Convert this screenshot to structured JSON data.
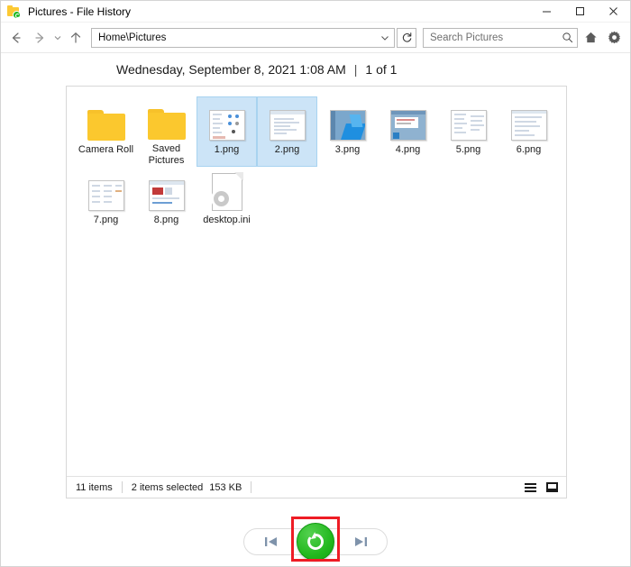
{
  "window": {
    "title": "Pictures - File History",
    "icon": "folder-history-icon",
    "controls": {
      "minimize": "minimize",
      "maximize": "maximize",
      "close": "close"
    }
  },
  "toolbar": {
    "back": "Back",
    "forward": "Forward",
    "recent": "Recent locations",
    "up": "Up",
    "address_value": "Home\\Pictures",
    "address_dropdown": "chevron-down-icon",
    "refresh": "Refresh",
    "search_placeholder": "Search Pictures",
    "search_icon": "search-icon",
    "home_icon": "home-icon",
    "settings_icon": "gear-icon"
  },
  "header": {
    "datetime": "Wednesday, September 8, 2021 1:08 AM",
    "separator": "|",
    "version_count": "1 of 1"
  },
  "files": [
    {
      "name": "Camera Roll",
      "type": "folder"
    },
    {
      "name": "Saved Pictures",
      "type": "folder"
    },
    {
      "name": "1.png",
      "type": "image",
      "selected": true
    },
    {
      "name": "2.png",
      "type": "image",
      "selected": true
    },
    {
      "name": "3.png",
      "type": "image",
      "selected": false
    },
    {
      "name": "4.png",
      "type": "image",
      "selected": false
    },
    {
      "name": "5.png",
      "type": "image",
      "selected": false
    },
    {
      "name": "6.png",
      "type": "image",
      "selected": false
    },
    {
      "name": "7.png",
      "type": "image",
      "selected": false
    },
    {
      "name": "8.png",
      "type": "image",
      "selected": false
    },
    {
      "name": "desktop.ini",
      "type": "config",
      "selected": false
    }
  ],
  "status": {
    "item_count": "11 items",
    "selection": "2 items selected",
    "size": "153 KB",
    "view_details_icon": "details-view-icon",
    "view_tiles_icon": "large-icons-view-icon"
  },
  "bottom": {
    "previous_label": "Previous version",
    "restore_label": "Restore",
    "next_label": "Next version",
    "restore_color": "#22b81e",
    "highlight_color": "#ee1c25"
  }
}
